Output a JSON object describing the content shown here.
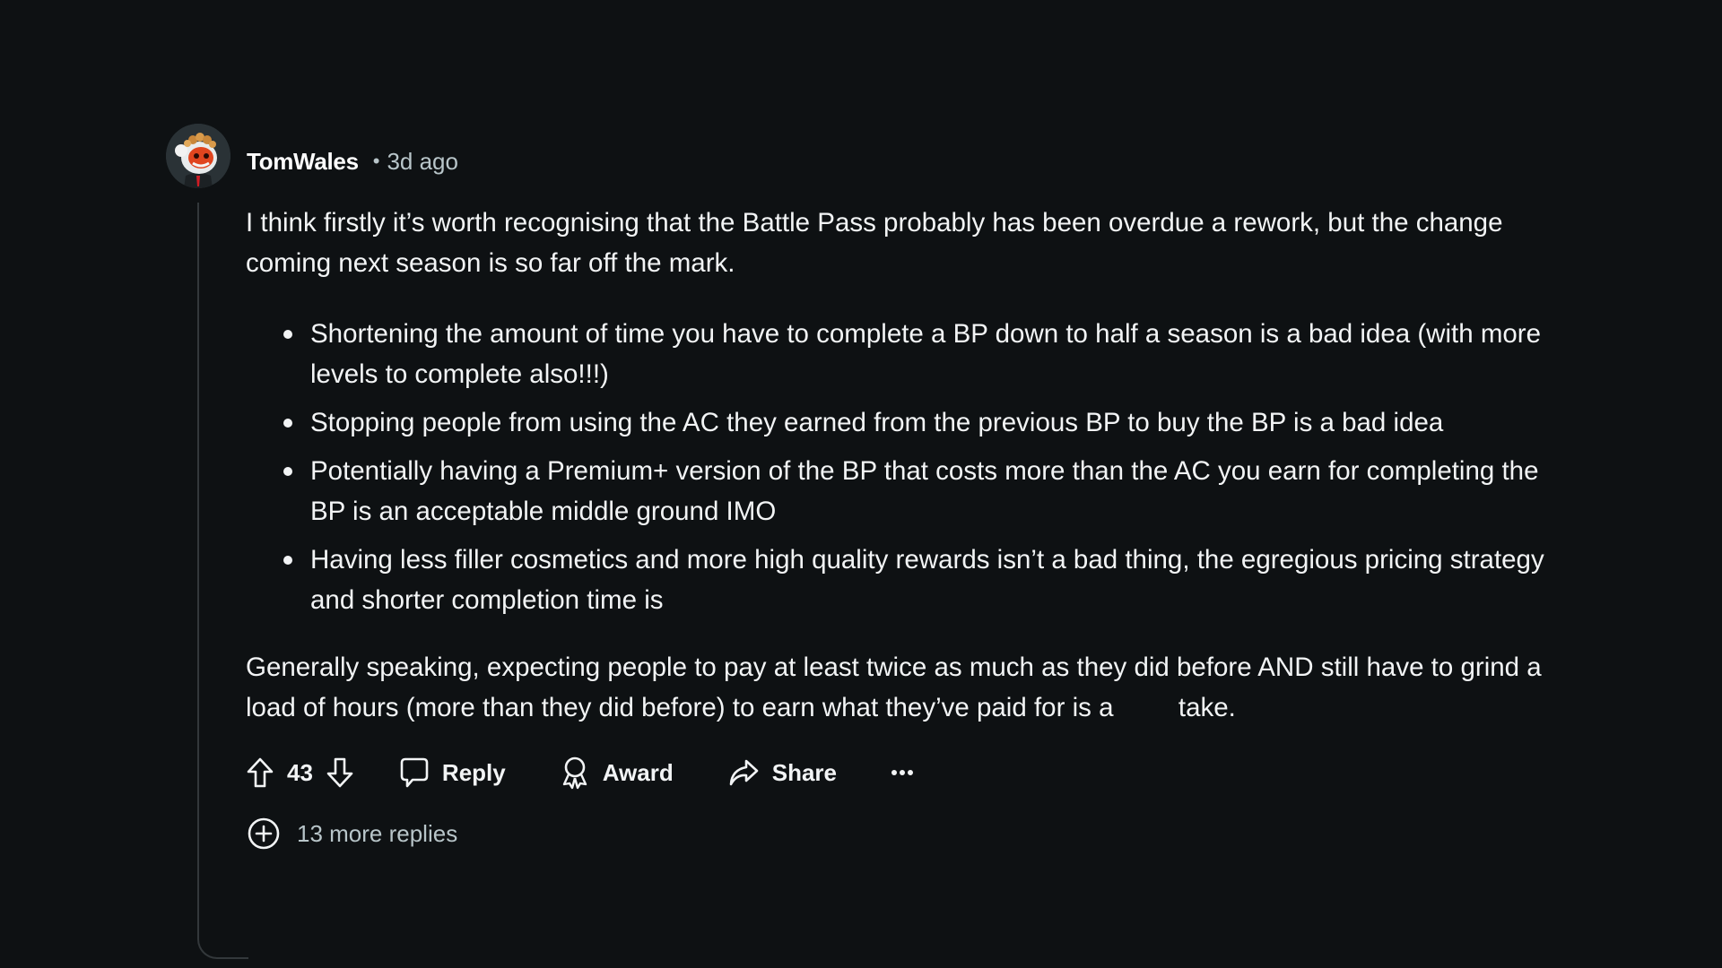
{
  "comment": {
    "author": "TomWales",
    "separator": "•",
    "timestamp": "3d ago",
    "avatar_icon": "snoo-avatar-icon",
    "intro": "I think firstly it’s worth recognising that the Battle Pass probably has been overdue a rework, but the change coming next season is so far off the mark.",
    "bullets": [
      "Shortening the amount of time you have to complete a BP down to half a season is a bad idea (with more levels to complete also!!!)",
      "Stopping people from using the AC they earned from the previous BP to buy the BP is a bad idea",
      "Potentially having a Premium+ version of the BP that costs more than the AC you earn for completing the BP is an acceptable middle ground IMO",
      "Having less filler cosmetics and more high quality rewards isn’t a bad thing, the egregious pricing strategy and shorter completion time is"
    ],
    "conclusion_before": "Generally speaking, expecting people to pay at least twice as much as they did before AND still have to grind a load of hours (more than they did before) to earn what they’ve paid for is a",
    "conclusion_after": "take.",
    "actions": {
      "upvote_icon": "arrow-up-icon",
      "vote_count": "43",
      "downvote_icon": "arrow-down-icon",
      "reply_label": "Reply",
      "award_label": "Award",
      "share_label": "Share",
      "more_icon": "ellipsis-icon"
    },
    "more_replies_label": "13 more replies"
  },
  "colors": {
    "background": "#0e1113",
    "text": "#f2f4f5",
    "muted": "#b8c5c9",
    "thread_line": "#33383b"
  }
}
